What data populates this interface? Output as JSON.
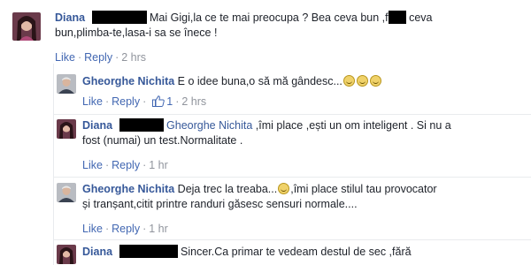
{
  "comments": [
    {
      "author": "Diana",
      "text_line1": "Mai Gigi,la ce te mai preocupa ? Bea ceva bun ,f",
      "text_line1_tail": " ceva",
      "text_line2": "bun,plimba-te,lasa-i sa se înece !",
      "like": "Like",
      "reply": "Reply",
      "time": "2 hrs"
    },
    {
      "author": "Gheorghe Nichita",
      "text": "E o idee buna,o să mă gândesc...",
      "like": "Like",
      "reply": "Reply",
      "likes_count": "1",
      "time": "2 hrs"
    },
    {
      "author": "Diana",
      "mention": "Gheorghe Nichita",
      "text_line1": " ,îmi place ,ești un om inteligent . Si nu a",
      "text_line2": "fost (numai) un test.Normalitate .",
      "like": "Like",
      "reply": "Reply",
      "time": "1 hr"
    },
    {
      "author": "Gheorghe Nichita",
      "text_line1_a": "Deja trec la treaba...",
      "text_line1_b": ",îmi place stilul tau provocator",
      "text_line2": "și tranșant,citit printre randuri găsesc sensuri normale....",
      "like": "Like",
      "reply": "Reply",
      "time": "1 hr"
    },
    {
      "author": "Diana",
      "text_line1": "Sincer.Ca primar te vedeam destul de sec ,fără"
    }
  ],
  "colors": {
    "author": "#365899",
    "link": "#4267b2",
    "meta": "#90949c"
  }
}
